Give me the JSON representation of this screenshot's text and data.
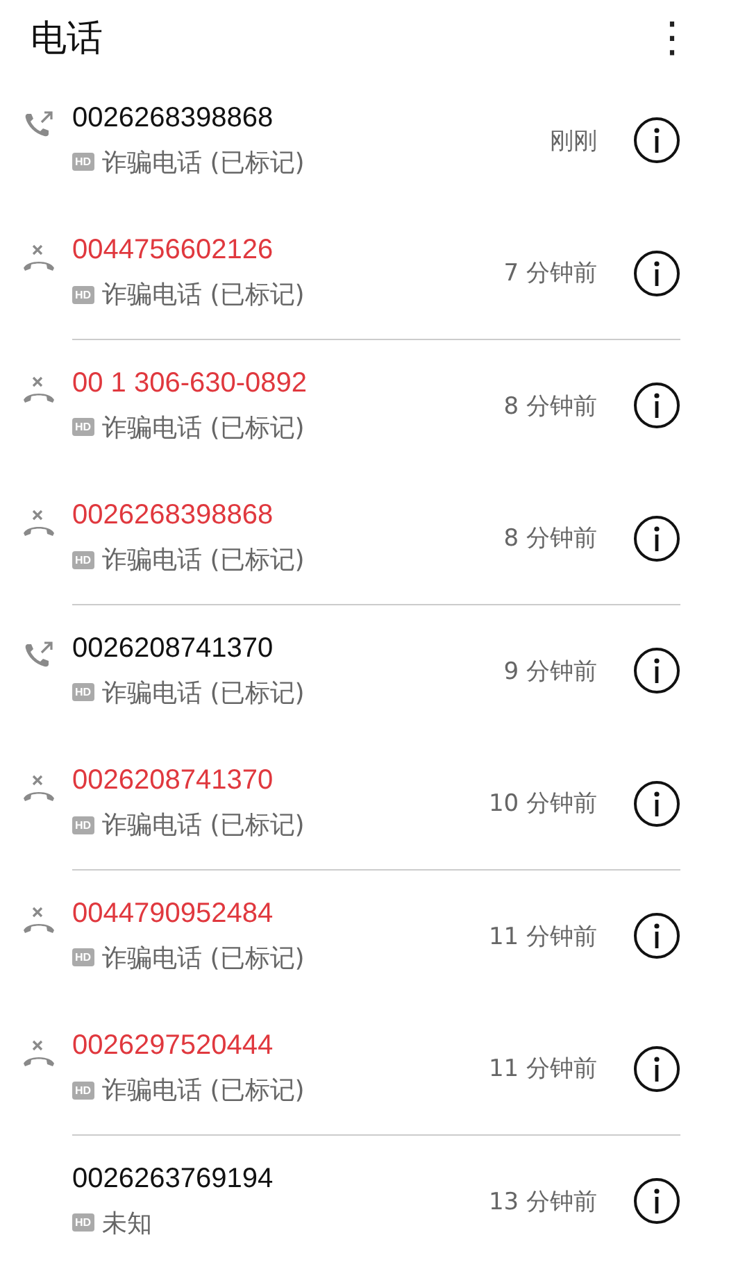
{
  "header": {
    "title": "电话",
    "menu": "⋮"
  },
  "calls": [
    {
      "kind": "outgoing",
      "number": "0026268398868",
      "badge": "HD",
      "label": "诈骗电话 (已标记)",
      "time": "刚刚",
      "divider": false
    },
    {
      "kind": "missed",
      "number": "0044756602126",
      "badge": "HD",
      "label": "诈骗电话 (已标记)",
      "time": "7 分钟前",
      "divider": true
    },
    {
      "kind": "missed",
      "number": "00 1 306-630-0892",
      "badge": "HD",
      "label": "诈骗电话 (已标记)",
      "time": "8 分钟前",
      "divider": false
    },
    {
      "kind": "missed",
      "number": "0026268398868",
      "badge": "HD",
      "label": "诈骗电话 (已标记)",
      "time": "8 分钟前",
      "divider": true
    },
    {
      "kind": "outgoing",
      "number": "0026208741370",
      "badge": "HD",
      "label": "诈骗电话 (已标记)",
      "time": "9 分钟前",
      "divider": false
    },
    {
      "kind": "missed",
      "number": "0026208741370",
      "badge": "HD",
      "label": "诈骗电话 (已标记)",
      "time": "10 分钟前",
      "divider": true
    },
    {
      "kind": "missed",
      "number": "0044790952484",
      "badge": "HD",
      "label": "诈骗电话 (已标记)",
      "time": "11 分钟前",
      "divider": false
    },
    {
      "kind": "missed",
      "number": "0026297520444",
      "badge": "HD",
      "label": "诈骗电话 (已标记)",
      "time": "11 分钟前",
      "divider": true
    },
    {
      "kind": "plain",
      "number": "0026263769194",
      "badge": "HD",
      "label": "未知",
      "time": "13 分钟前",
      "divider": false
    }
  ]
}
